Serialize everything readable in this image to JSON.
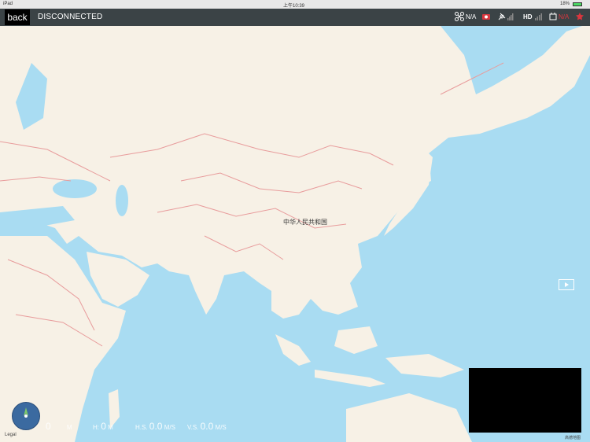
{
  "status_bar": {
    "left": "iPad",
    "time": "上午10:39",
    "battery": "18%"
  },
  "top_bar": {
    "back_label": "back",
    "connection_status": "DISCONNECTED",
    "aircraft_value": "N/A",
    "video_quality": "HD",
    "rc_value": "N/A"
  },
  "map": {
    "country_label": "中华人民共和国",
    "legal_label": "Legal",
    "attribution": "高德地图"
  },
  "telemetry": {
    "d_value": "0",
    "d_unit": "M",
    "h_label": "H:",
    "h_value": "0",
    "h_unit": "M",
    "hs_label": "H.S.",
    "hs_value": "0.0",
    "hs_unit": "M/S",
    "vs_label": "V.S.",
    "vs_value": "0.0",
    "vs_unit": "M/S"
  },
  "colors": {
    "water": "#a9dcf2",
    "land": "#f7f1e6",
    "border": "#e89c9c",
    "alert": "#d9363e"
  }
}
